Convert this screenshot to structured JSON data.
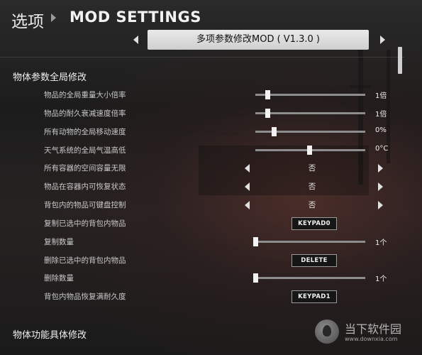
{
  "header": {
    "breadcrumb": "选项",
    "title": "MOD SETTINGS"
  },
  "mod_selector": {
    "current": "多项参数修改MOD ( V1.3.0 )"
  },
  "sections": [
    {
      "title": "物体参数全局修改"
    },
    {
      "title": "物体功能具体修改"
    }
  ],
  "settings": [
    {
      "label": "物品的全局重量大小倍率",
      "type": "slider",
      "level": 0.11,
      "value": "1倍"
    },
    {
      "label": "物品的耐久衰减速度倍率",
      "type": "slider",
      "level": 0.11,
      "value": "1倍"
    },
    {
      "label": "所有动物的全局移动速度",
      "type": "slider",
      "level": 0.17,
      "value": "0%"
    },
    {
      "label": "天气系统的全局气温高低",
      "type": "slider",
      "level": 0.49,
      "value": "0°C"
    },
    {
      "label": "所有容器的空间容量无限",
      "type": "selector",
      "value": "否"
    },
    {
      "label": "物品在容器内可恢复状态",
      "type": "selector",
      "value": "否"
    },
    {
      "label": "背包内的物品可键盘控制",
      "type": "selector",
      "value": "否"
    },
    {
      "label": "复制已选中的背包内物品",
      "type": "keybind",
      "value": "KEYPAD0"
    },
    {
      "label": "复制数量",
      "type": "slider",
      "level": 0.0,
      "value": "1个"
    },
    {
      "label": "删除已选中的背包内物品",
      "type": "keybind",
      "value": "DELETE"
    },
    {
      "label": "删除数量",
      "type": "slider",
      "level": 0.0,
      "value": "1个"
    },
    {
      "label": "背包内物品恢复满耐久度",
      "type": "keybind",
      "value": "KEYPAD1"
    }
  ],
  "watermark": {
    "main": "当下软件园",
    "sub": "www.downxia.com"
  },
  "colors": {
    "text_primary": "#f0f0f0",
    "text_label": "#c8c8c8",
    "slider_track": "#8d8d8d",
    "selector_box": "#dcdcdc"
  }
}
